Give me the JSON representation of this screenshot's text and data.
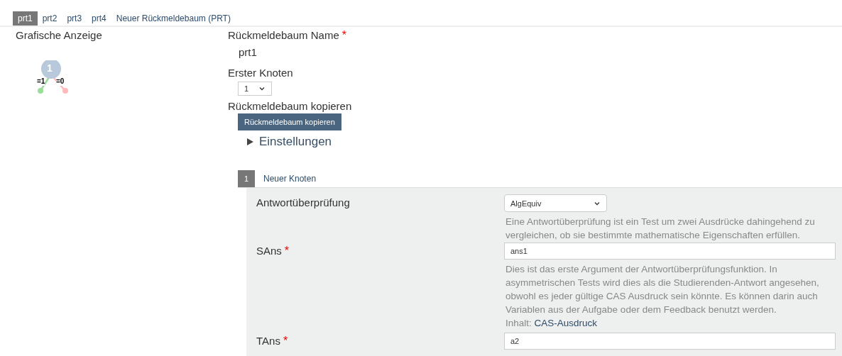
{
  "tabs": [
    {
      "label": "prt1",
      "selected": true
    },
    {
      "label": "prt2",
      "selected": false
    },
    {
      "label": "prt3",
      "selected": false
    },
    {
      "label": "prt4",
      "selected": false
    },
    {
      "label": "Neuer Rückmeldebaum (PRT)",
      "selected": false
    }
  ],
  "graph": {
    "title": "Grafische Anzeige",
    "node": "1",
    "true_label": "=1",
    "false_label": "=0"
  },
  "prt_name": {
    "label": "Rückmeldebaum Name",
    "required_mark": "*",
    "value": "prt1"
  },
  "first_node": {
    "label": "Erster Knoten",
    "value": "1"
  },
  "copy": {
    "label": "Rückmeldebaum kopieren",
    "button": "Rückmeldebaum kopieren"
  },
  "settings": {
    "label": "Einstellungen",
    "expanded": false
  },
  "node": {
    "number": "1",
    "title": "Neuer Knoten",
    "fields": [
      {
        "kind": "select",
        "label": "Antwortüberprüfung",
        "value": "AlgEquiv",
        "help": "Eine Antwortüberprüfung ist ein Test um zwei Ausdrücke dahingehend zu vergleichen, ob sie bestimmte mathematische Eigenschaften erfüllen."
      },
      {
        "kind": "input",
        "label": "SAns",
        "required_mark": "*",
        "value": "ans1",
        "help": "Dies ist das erste Argument der Antwortüberprüfungsfunktion. In asymmetrischen Tests wird dies als die Studierenden-Antwort angesehen, obwohl es jeder gültige CAS Ausdruck sein könnte. Es können darin auch Variablen aus der Aufgabe oder dem Feedback benutzt werden.",
        "content_label": "Inhalt:",
        "content_link": "CAS-Ausdruck"
      },
      {
        "kind": "input",
        "label": "TAns",
        "required_mark": "*",
        "value": "a2"
      }
    ]
  }
}
